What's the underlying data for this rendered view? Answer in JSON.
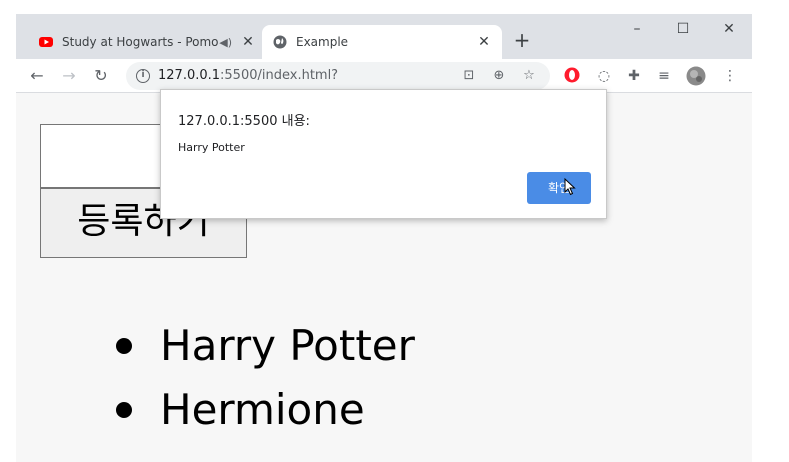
{
  "browser": {
    "tabs": [
      {
        "title": "Study at Hogwarts - Pomodoro",
        "favicon": "youtube-icon",
        "audio": "speaker-icon"
      },
      {
        "title": "Example",
        "favicon": "globe-icon"
      }
    ],
    "new_tab_glyph": "+",
    "url_host": "127.0.0.1",
    "url_path": ":5500/index.html?",
    "colors": {
      "tab_strip": "#dee1e6",
      "accent_blue": "#4a8ce6"
    }
  },
  "page": {
    "register_button_label": "등록하기",
    "input_value": "",
    "names": [
      "Harry Potter",
      "Hermione"
    ]
  },
  "alert": {
    "title": "127.0.0.1:5500 내용:",
    "message": "Harry Potter",
    "ok_label": "확인"
  }
}
